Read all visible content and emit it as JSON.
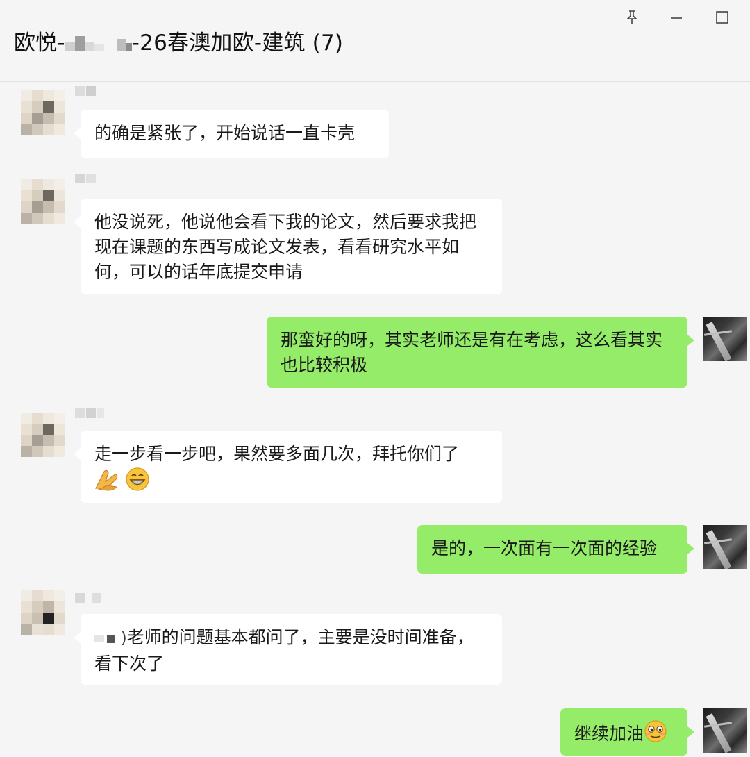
{
  "window": {
    "title_prefix": "欧悦-",
    "title_suffix": "-26春澳加欧-建筑 (7)",
    "pin_icon": "pin-icon",
    "minimize_icon": "minimize-icon",
    "maximize_icon": "maximize-icon"
  },
  "messages": [
    {
      "side": "in",
      "text": "的确是紧张了，开始说话一直卡壳"
    },
    {
      "side": "in",
      "text": "他没说死，他说他会看下我的论文，然后要求我把现在课题的东西写成论文发表，看看研究水平如何，可以的话年底提交申请"
    },
    {
      "side": "out",
      "text": "那蛮好的呀，其实老师还是有在考虑，这么看其实也比较积极"
    },
    {
      "side": "in",
      "text": "走一步看一步吧，果然要多面几次，拜托你们了",
      "emoji": [
        "clapping-hands-emoji",
        "grinning-face-emoji"
      ]
    },
    {
      "side": "out",
      "text": "是的，一次面有一次面的经验"
    },
    {
      "side": "in",
      "text": "老师的问题基本都问了，主要是没时间准备，看下次了",
      "redacted_prefix": true
    },
    {
      "side": "out",
      "text": "继续加油",
      "emoji": [
        "nervous-smile-emoji"
      ]
    }
  ],
  "colors": {
    "background": "#f5f5f5",
    "incoming_bubble": "#ffffff",
    "outgoing_bubble": "#95ec69"
  }
}
